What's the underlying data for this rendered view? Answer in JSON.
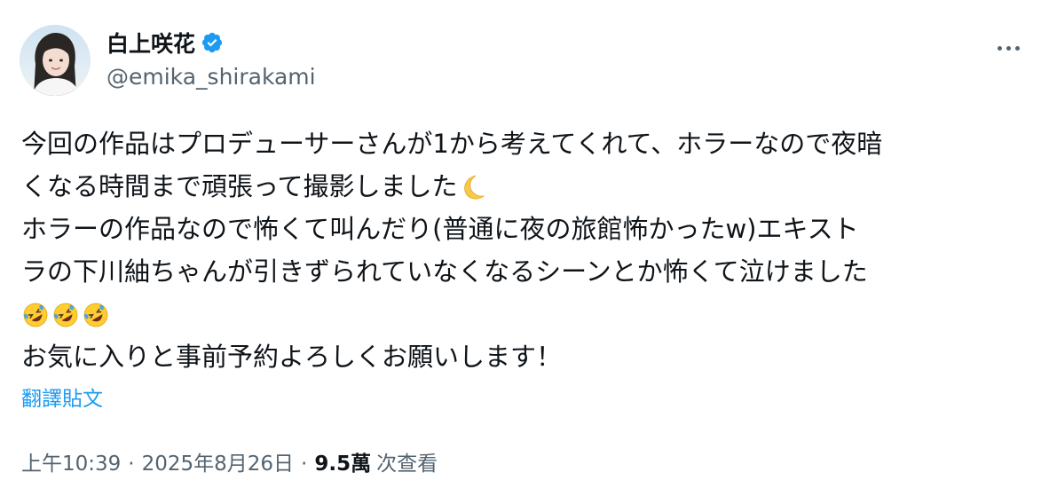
{
  "author": {
    "display_name": "白上咲花",
    "handle": "@emika_shirakami",
    "verified_icon": "verified-badge-icon",
    "avatar_icon": "avatar-photo"
  },
  "tweet": {
    "lines": [
      "今回の作品はプロデューサーさんが1から考えてくれて、ホラーなので夜暗",
      "くなる時間まで頑張って撮影しました",
      "ホラーの作品なので怖くて叫んだり(普通に夜の旅館怖かったw)エキスト",
      "ラの下川紬ちゃんが引きずられていなくなるシーンとか怖くて泣けました",
      "お気に入りと事前予約よろしくお願いします！"
    ],
    "emoji": {
      "moon": "crescent-moon-emoji",
      "laugh": "rolling-on-floor-laughing-emoji"
    }
  },
  "translate_label": "翻譯貼文",
  "meta": {
    "time": "上午10:39",
    "date": "2025年8月26日",
    "separator": "·",
    "views_count": "9.5萬",
    "views_label": "次查看"
  },
  "colors": {
    "text": "#0f1419",
    "secondary": "#536471",
    "link": "#1d9bf0",
    "verified": "#1d9bf0"
  }
}
